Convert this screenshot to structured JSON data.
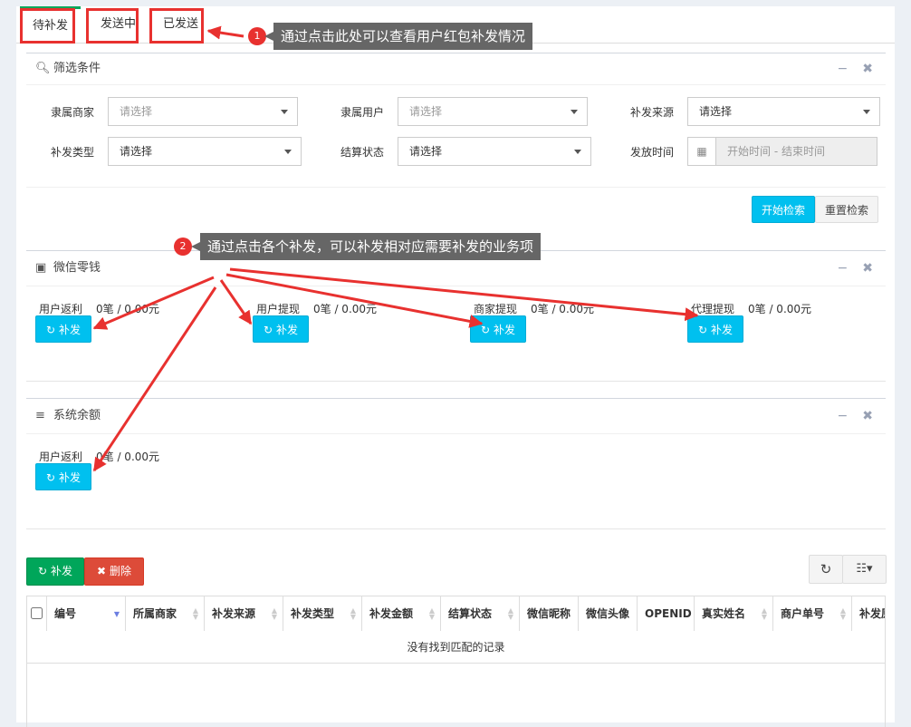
{
  "tabs": [
    {
      "label": "待补发",
      "active": true
    },
    {
      "label": "发送中",
      "active": false
    },
    {
      "label": "已发送",
      "active": false
    }
  ],
  "annotations": [
    {
      "badge": "1",
      "text": "通过点击此处可以查看用户红包补发情况"
    },
    {
      "badge": "2",
      "text": "通过点击各个补发，可以补发相对应需要补发的业务项"
    }
  ],
  "filter": {
    "title": "筛选条件",
    "fields": [
      {
        "label": "隶属商家",
        "value": "请选择"
      },
      {
        "label": "隶属用户",
        "value": "请选择"
      },
      {
        "label": "补发来源",
        "value": "请选择"
      },
      {
        "label": "补发类型",
        "value": "请选择"
      },
      {
        "label": "结算状态",
        "value": "请选择"
      },
      {
        "label": "发放时间",
        "placeholder": "开始时间 - 结束时间"
      }
    ],
    "search_btn": "开始检索",
    "reset_btn": "重置检索"
  },
  "wechat": {
    "title": "微信零钱",
    "items": [
      {
        "label": "用户返利",
        "value": "0笔 / 0.00元",
        "btn": "补发"
      },
      {
        "label": "用户提现",
        "value": "0笔 / 0.00元",
        "btn": "补发"
      },
      {
        "label": "商家提现",
        "value": "0笔 / 0.00元",
        "btn": "补发"
      },
      {
        "label": "代理提现",
        "value": "0笔 / 0.00元",
        "btn": "补发"
      }
    ]
  },
  "balance": {
    "title": "系统余额",
    "items": [
      {
        "label": "用户返利",
        "value": "0笔 / 0.00元",
        "btn": "补发"
      }
    ]
  },
  "toolbar": {
    "reissue": "补发",
    "delete": "删除"
  },
  "table": {
    "columns": [
      "编号",
      "所属商家",
      "补发来源",
      "补发类型",
      "补发金额",
      "结算状态",
      "微信昵称",
      "微信头像",
      "OPENID",
      "真实姓名",
      "商户单号",
      "补发原因"
    ],
    "empty": "没有找到匹配的记录"
  },
  "colors": {
    "accent": "#00c0ef",
    "success": "#00a65a",
    "danger": "#dd4b39",
    "annotation_red": "#e8312f"
  }
}
